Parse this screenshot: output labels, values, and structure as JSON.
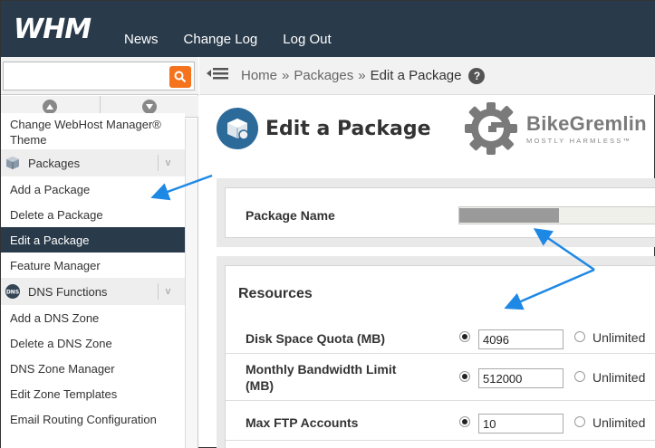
{
  "app": {
    "logo": "WHM"
  },
  "topnav": [
    "News",
    "Change Log",
    "Log Out"
  ],
  "search": {
    "value": ""
  },
  "sidebar": {
    "items": [
      {
        "type": "item",
        "label": "Change WebHost Manager® Theme"
      },
      {
        "type": "group",
        "label": "Packages"
      },
      {
        "type": "item",
        "label": "Add a Package"
      },
      {
        "type": "item",
        "label": "Delete a Package"
      },
      {
        "type": "item",
        "label": "Edit a Package",
        "active": true
      },
      {
        "type": "item",
        "label": "Feature Manager"
      },
      {
        "type": "group",
        "label": "DNS Functions"
      },
      {
        "type": "item",
        "label": "Add a DNS Zone"
      },
      {
        "type": "item",
        "label": "Delete a DNS Zone"
      },
      {
        "type": "item",
        "label": "DNS Zone Manager"
      },
      {
        "type": "item",
        "label": "Edit Zone Templates"
      },
      {
        "type": "item",
        "label": "Email Routing Configuration"
      }
    ],
    "group_icon_text": "DNS"
  },
  "breadcrumb": {
    "home": "Home",
    "packages": "Packages",
    "current": "Edit a Package",
    "sep": "»",
    "help": "?"
  },
  "page": {
    "title": "Edit a Package"
  },
  "brand": {
    "name": "BikeGremlin",
    "tagline": "MOSTLY HARMLESS™"
  },
  "package_name": {
    "label": "Package Name"
  },
  "resources": {
    "heading": "Resources",
    "unlimited_label": "Unlimited",
    "rows": [
      {
        "label": "Disk Space Quota (MB)",
        "value": "4096"
      },
      {
        "label": "Monthly Bandwidth Limit (MB)",
        "value": "512000"
      },
      {
        "label": "Max FTP Accounts",
        "value": "10"
      }
    ]
  },
  "colors": {
    "topbar": "#293a4a",
    "accent": "#f5731c",
    "arrow": "#1e88e5"
  }
}
